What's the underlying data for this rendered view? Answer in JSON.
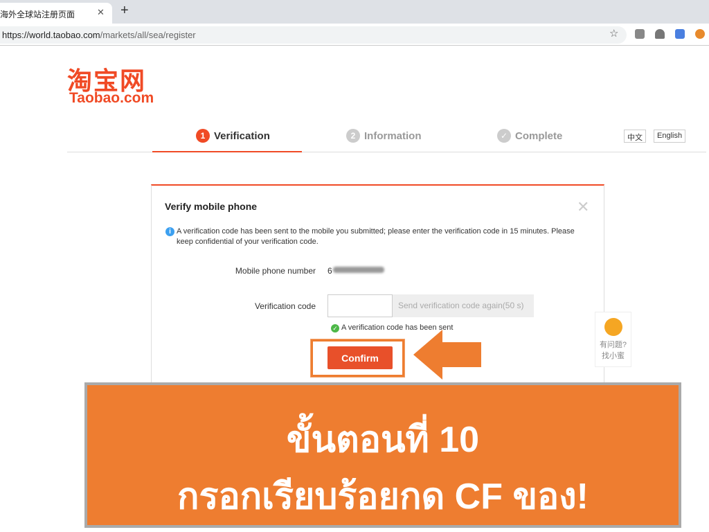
{
  "browser": {
    "tab_title": "海外全球站注册页面",
    "url_host": "https://world.taobao.com",
    "url_path": "/markets/all/sea/register"
  },
  "logo": {
    "cn": "淘宝网",
    "en": "Taobao.com"
  },
  "steps": [
    {
      "num": "1",
      "label": "Verification"
    },
    {
      "num": "2",
      "label": "Information"
    },
    {
      "num": "✓",
      "label": "Complete"
    }
  ],
  "lang": {
    "cn": "中文",
    "en": "English"
  },
  "dialog": {
    "title": "Verify mobile phone",
    "info": "A verification code has been sent to the mobile you submitted; please enter the verification code in 15 minutes. Please keep confidential of your verification code.",
    "phone_label": "Mobile phone number",
    "phone_value": "6",
    "code_label": "Verification code",
    "code_value": "",
    "resend": "Send verification code again(50 s)",
    "sent_msg": "A verification code has been sent",
    "confirm": "Confirm"
  },
  "helper": {
    "text1": "有问题?",
    "text2": "找小蜜"
  },
  "banner": {
    "line1": "ขั้นตอนที่ 10",
    "line2": "กรอกเรียบร้อยกด CF ของ!",
    "color": "#ee7d30"
  }
}
